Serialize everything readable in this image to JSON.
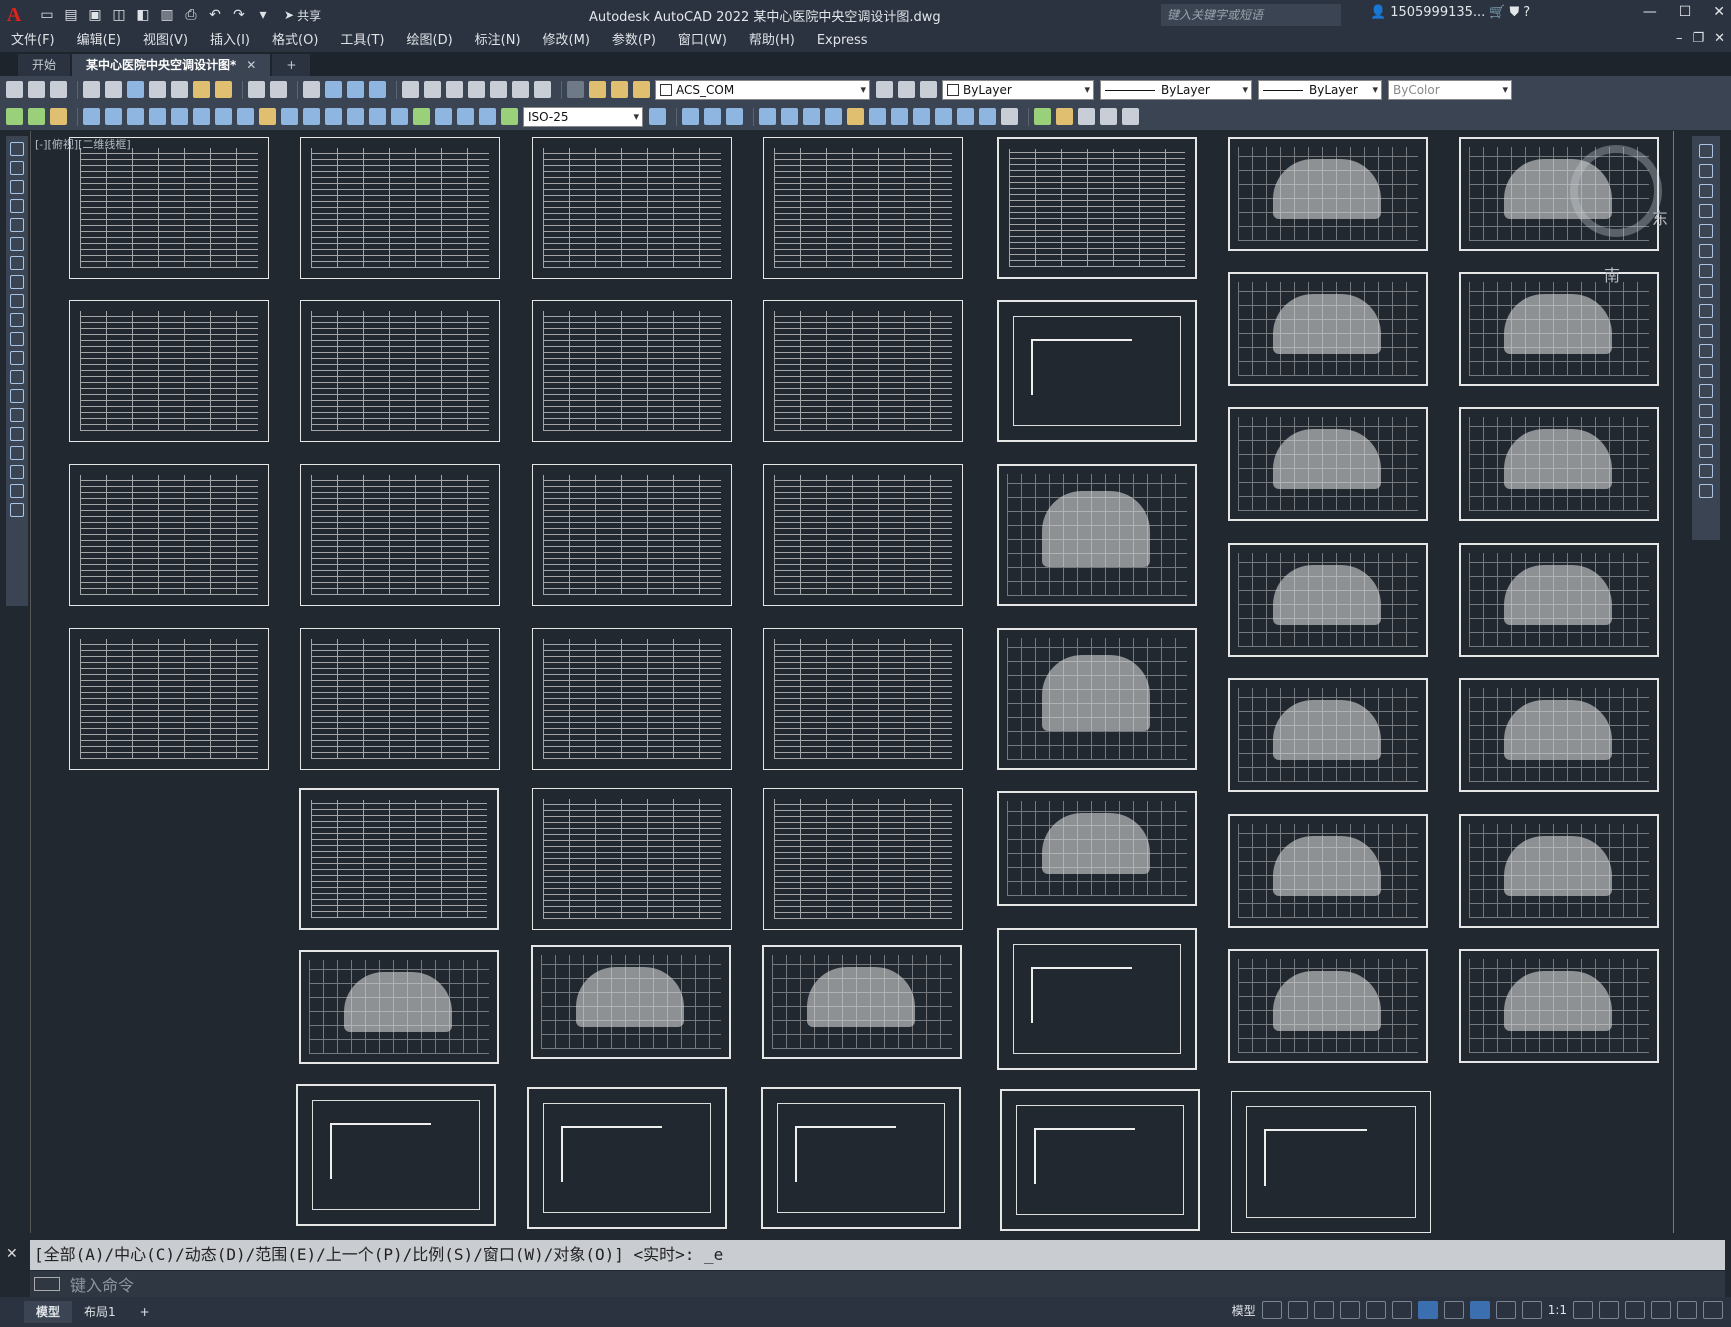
{
  "titlebar": {
    "logo": "A",
    "share_label": "共享",
    "title": "Autodesk AutoCAD 2022    某中心医院中央空调设计图.dwg",
    "search_placeholder": "键入关键字或短语",
    "user": "1505999135...",
    "win_min": "—",
    "win_max": "☐",
    "win_close": "✕"
  },
  "menu": {
    "items": [
      "文件(F)",
      "编辑(E)",
      "视图(V)",
      "插入(I)",
      "格式(O)",
      "工具(T)",
      "绘图(D)",
      "标注(N)",
      "修改(M)",
      "参数(P)",
      "窗口(W)",
      "帮助(H)",
      "Express"
    ]
  },
  "tabs": {
    "start": "开始",
    "doc": "某中心医院中央空调设计图*",
    "close": "✕",
    "add": "+"
  },
  "toolbar": {
    "layer_name": "ACS_COM",
    "color": "ByLayer",
    "linetype": "ByLayer",
    "lineweight": "ByLayer",
    "plotstyle": "ByColor",
    "dimstyle": "ISO-25"
  },
  "viewport": {
    "label": "[-][俯视][二维线框]"
  },
  "compass": {
    "east": "东",
    "south": "南"
  },
  "command": {
    "history": "[全部(A)/中心(C)/动态(D)/范围(E)/上一个(P)/比例(S)/窗口(W)/对象(O)] <实时>: _e",
    "placeholder": "键入命令"
  },
  "status": {
    "tab_model": "模型",
    "tab_layout1": "布局1",
    "tab_add": "+",
    "model_label": "模型",
    "scale": "1:1"
  }
}
